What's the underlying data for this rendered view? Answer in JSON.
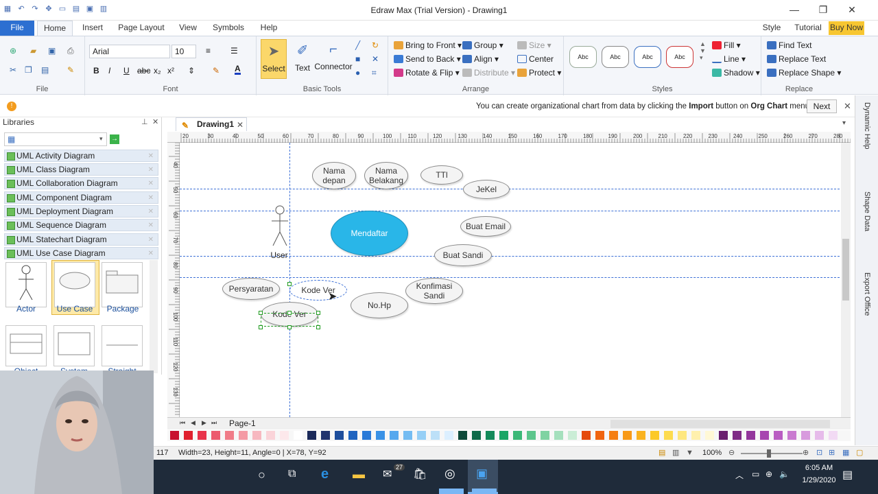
{
  "window": {
    "title": "Edraw Max (Trial Version) - Drawing1"
  },
  "tabs": [
    "File",
    "Home",
    "Insert",
    "Page Layout",
    "View",
    "Symbols",
    "Help"
  ],
  "right_menu": {
    "style": "Style",
    "tutorial": "Tutorial",
    "buy": "Buy Now"
  },
  "ribbon": {
    "file": {
      "label": "File"
    },
    "font": {
      "name": "Arial",
      "size": "10",
      "label": "Font"
    },
    "basic_tools": {
      "select": "Select",
      "text": "Text",
      "connector": "Connector",
      "label": "Basic Tools"
    },
    "arrange": {
      "bring_front": "Bring to Front",
      "send_back": "Send to Back",
      "rotate_flip": "Rotate & Flip",
      "group": "Group",
      "align": "Align",
      "distribute": "Distribute",
      "size": "Size",
      "center": "Center",
      "protect": "Protect",
      "label": "Arrange"
    },
    "styles": {
      "sample": "Abc",
      "fill": "Fill",
      "line": "Line",
      "shadow": "Shadow",
      "label": "Styles"
    },
    "replace": {
      "find": "Find Text",
      "replace": "Replace Text",
      "replace_shape": "Replace Shape",
      "label": "Replace"
    }
  },
  "notification": {
    "text_pre": "You can create organizational chart from data by clicking the ",
    "bold1": "Import",
    "text_mid": " button on ",
    "bold2": "Org Chart",
    "text_post": " menu.",
    "next": "Next"
  },
  "libraries": {
    "title": "Libraries",
    "items": [
      "UML Activity Diagram",
      "UML Class Diagram",
      "UML Collaboration Diagram",
      "UML Component Diagram",
      "UML Deployment Diagram",
      "UML Sequence Diagram",
      "UML Statechart Diagram",
      "UML Use Case Diagram"
    ],
    "shapes": [
      "Actor",
      "Use Case",
      "Package"
    ],
    "shapes_row2": [
      "Object",
      "System",
      "Straight"
    ]
  },
  "document": {
    "tab": "Drawing1",
    "page": "Page-1"
  },
  "ruler_top": [
    "20",
    "30",
    "40",
    "50",
    "60",
    "70",
    "80",
    "90",
    "100",
    "110",
    "120",
    "130",
    "140",
    "150",
    "160",
    "170",
    "180",
    "190",
    "200",
    "210",
    "220",
    "230",
    "240",
    "250",
    "260",
    "270",
    "280"
  ],
  "ruler_left": [
    "40",
    "50",
    "60",
    "70",
    "80",
    "90",
    "100",
    "110",
    "120",
    "130"
  ],
  "diagram": {
    "nodes": [
      "Nama depan",
      "Nama Belakang",
      "TTl",
      "JeKel",
      "Mendaftar",
      "Buat Email",
      "Buat Sandi",
      "Persyaratan",
      "Kode Ver",
      "Kode Ver",
      "Konfimasi Sandi",
      "No.Hp"
    ],
    "actor": "User"
  },
  "side_panels": [
    "Dynamic Help",
    "Shape Data",
    "Export Office"
  ],
  "status": {
    "left": "117",
    "info": "Width=23, Height=11, Angle=0 | X=78, Y=92",
    "zoom": "100%"
  },
  "taskbar": {
    "time": "6:05 AM",
    "date": "1/29/2020",
    "badge": "27"
  },
  "colors": {
    "accent": "#2c6fd1",
    "usecase_fill": "#29b6e8",
    "buy": "#f7c631"
  }
}
